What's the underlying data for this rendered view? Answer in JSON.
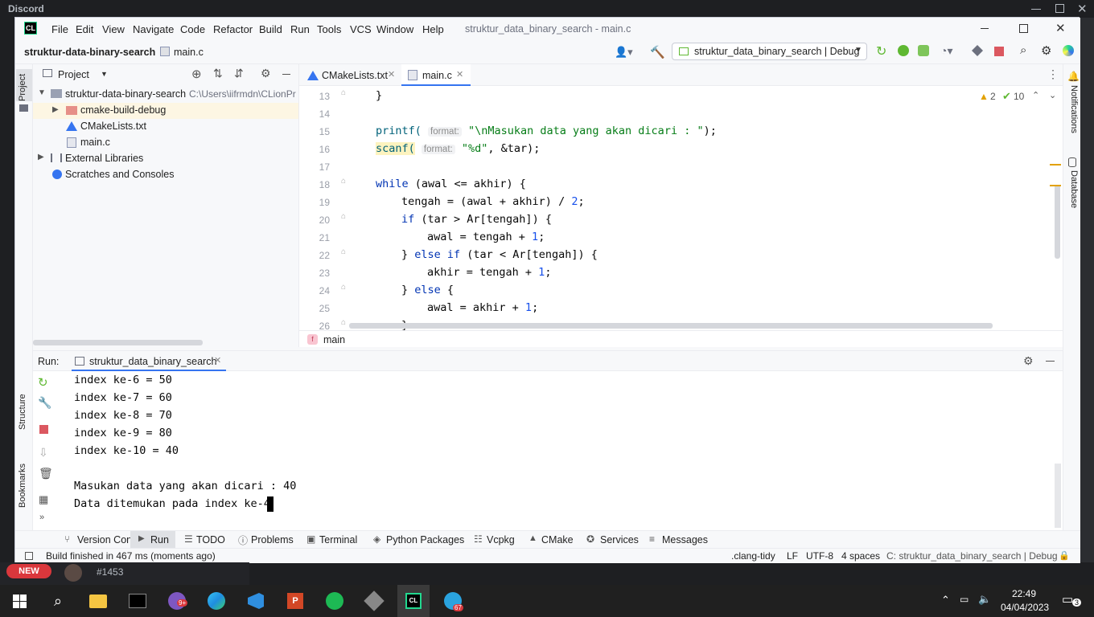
{
  "discord": {
    "title": "Discord",
    "new_badge": "NEW",
    "user_tag": "#1453"
  },
  "menu": {
    "items": [
      "File",
      "Edit",
      "View",
      "Navigate",
      "Code",
      "Refactor",
      "Build",
      "Run",
      "Tools",
      "VCS",
      "Window",
      "Help"
    ],
    "window_title": "struktur_data_binary_search - main.c"
  },
  "nav": {
    "project": "struktur-data-binary-search",
    "file": "main.c",
    "run_config": "struktur_data_binary_search | Debug"
  },
  "project_pane": {
    "header": "Project",
    "root": "struktur-data-binary-search",
    "root_path": "C:\\Users\\iifrmdn\\CLionPr",
    "items": [
      "cmake-build-debug",
      "CMakeLists.txt",
      "main.c"
    ],
    "external": "External Libraries",
    "scratches": "Scratches and Consoles"
  },
  "editor": {
    "tabs": [
      "CMakeLists.txt",
      "main.c"
    ],
    "warnings": "2",
    "checks": "10",
    "breadcrumb": "main",
    "line_numbers": [
      "13",
      "14",
      "15",
      "16",
      "17",
      "18",
      "19",
      "20",
      "21",
      "22",
      "23",
      "24",
      "25",
      "26"
    ],
    "hint_format": "format:",
    "code": {
      "l13": "}",
      "l15_fn": "printf(",
      "l15_str": "\"\\nMasukan data yang akan dicari : \"",
      "l15_end": ");",
      "l16_fn": "scanf(",
      "l16_str": "\"%d\"",
      "l16_end": ", &tar);",
      "l18_kw": "while",
      "l18_rest": " (awal <= akhir) {",
      "l19_a": "tengah = (awal + akhir) / ",
      "l19_num": "2",
      "l19_end": ";",
      "l20_kw": "if",
      "l20_rest": " (tar > Ar[tengah]) {",
      "l21_a": "awal = tengah + ",
      "l21_num": "1",
      "l21_end": ";",
      "l22_a": "} ",
      "l22_kw": "else if",
      "l22_rest": " (tar < Ar[tengah]) {",
      "l23_a": "akhir = tengah + ",
      "l23_num": "1",
      "l23_end": ";",
      "l24_a": "} ",
      "l24_kw": "else",
      "l24_rest": " {",
      "l25_a": "awal = akhir + ",
      "l25_num": "1",
      "l25_end": ";",
      "l26": "}"
    }
  },
  "run": {
    "label": "Run:",
    "tab": "struktur_data_binary_search",
    "output": [
      "index ke-6 = 50",
      "index ke-7 = 60",
      "index ke-8 = 70",
      "index ke-9 = 80",
      "index ke-10 = 40",
      "",
      "Masukan data yang akan dicari : 40",
      "Data ditemukan pada index ke-4"
    ]
  },
  "left_strip": {
    "project": "Project",
    "structure": "Structure",
    "bookmarks": "Bookmarks"
  },
  "right_strip": {
    "notifications": "Notifications",
    "database": "Database"
  },
  "bottom_tabs": [
    "Version Control",
    "Run",
    "TODO",
    "Problems",
    "Terminal",
    "Python Packages",
    "Vcpkg",
    "CMake",
    "Services",
    "Messages"
  ],
  "status": {
    "message": "Build finished in 467 ms (moments ago)",
    "clang": ".clang-tidy",
    "lf": "LF",
    "encoding": "UTF-8",
    "indent": "4 spaces",
    "context": "C: struktur_data_binary_search | Debug"
  },
  "taskbar": {
    "time": "22:49",
    "date": "04/04/2023",
    "notif_count": "3",
    "chrome_badge": "9+",
    "telegram_badge": "67"
  },
  "colors": {
    "accent": "#3574f0",
    "warning": "#e2a100",
    "ok": "#5fb832"
  }
}
